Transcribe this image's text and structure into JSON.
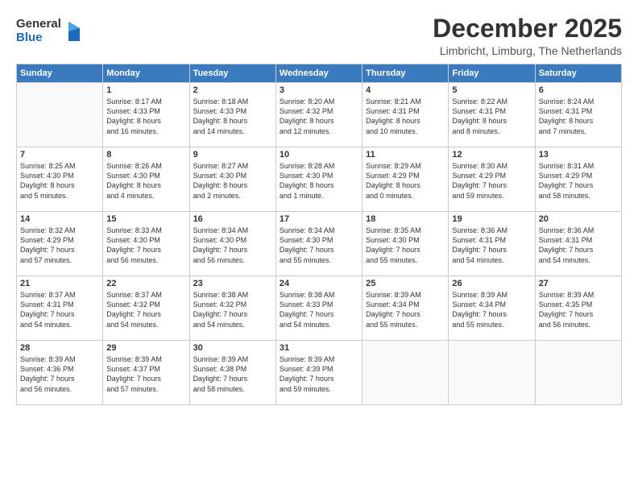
{
  "logo": {
    "general": "General",
    "blue": "Blue"
  },
  "header": {
    "month": "December 2025",
    "location": "Limbricht, Limburg, The Netherlands"
  },
  "weekdays": [
    "Sunday",
    "Monday",
    "Tuesday",
    "Wednesday",
    "Thursday",
    "Friday",
    "Saturday"
  ],
  "weeks": [
    [
      {
        "day": "",
        "info": ""
      },
      {
        "day": "1",
        "info": "Sunrise: 8:17 AM\nSunset: 4:33 PM\nDaylight: 8 hours\nand 16 minutes."
      },
      {
        "day": "2",
        "info": "Sunrise: 8:18 AM\nSunset: 4:33 PM\nDaylight: 8 hours\nand 14 minutes."
      },
      {
        "day": "3",
        "info": "Sunrise: 8:20 AM\nSunset: 4:32 PM\nDaylight: 8 hours\nand 12 minutes."
      },
      {
        "day": "4",
        "info": "Sunrise: 8:21 AM\nSunset: 4:31 PM\nDaylight: 8 hours\nand 10 minutes."
      },
      {
        "day": "5",
        "info": "Sunrise: 8:22 AM\nSunset: 4:31 PM\nDaylight: 8 hours\nand 8 minutes."
      },
      {
        "day": "6",
        "info": "Sunrise: 8:24 AM\nSunset: 4:31 PM\nDaylight: 8 hours\nand 7 minutes."
      }
    ],
    [
      {
        "day": "7",
        "info": "Sunrise: 8:25 AM\nSunset: 4:30 PM\nDaylight: 8 hours\nand 5 minutes."
      },
      {
        "day": "8",
        "info": "Sunrise: 8:26 AM\nSunset: 4:30 PM\nDaylight: 8 hours\nand 4 minutes."
      },
      {
        "day": "9",
        "info": "Sunrise: 8:27 AM\nSunset: 4:30 PM\nDaylight: 8 hours\nand 2 minutes."
      },
      {
        "day": "10",
        "info": "Sunrise: 8:28 AM\nSunset: 4:30 PM\nDaylight: 8 hours\nand 1 minute."
      },
      {
        "day": "11",
        "info": "Sunrise: 8:29 AM\nSunset: 4:29 PM\nDaylight: 8 hours\nand 0 minutes."
      },
      {
        "day": "12",
        "info": "Sunrise: 8:30 AM\nSunset: 4:29 PM\nDaylight: 7 hours\nand 59 minutes."
      },
      {
        "day": "13",
        "info": "Sunrise: 8:31 AM\nSunset: 4:29 PM\nDaylight: 7 hours\nand 58 minutes."
      }
    ],
    [
      {
        "day": "14",
        "info": "Sunrise: 8:32 AM\nSunset: 4:29 PM\nDaylight: 7 hours\nand 57 minutes."
      },
      {
        "day": "15",
        "info": "Sunrise: 8:33 AM\nSunset: 4:30 PM\nDaylight: 7 hours\nand 56 minutes."
      },
      {
        "day": "16",
        "info": "Sunrise: 8:34 AM\nSunset: 4:30 PM\nDaylight: 7 hours\nand 56 minutes."
      },
      {
        "day": "17",
        "info": "Sunrise: 8:34 AM\nSunset: 4:30 PM\nDaylight: 7 hours\nand 55 minutes."
      },
      {
        "day": "18",
        "info": "Sunrise: 8:35 AM\nSunset: 4:30 PM\nDaylight: 7 hours\nand 55 minutes."
      },
      {
        "day": "19",
        "info": "Sunrise: 8:36 AM\nSunset: 4:31 PM\nDaylight: 7 hours\nand 54 minutes."
      },
      {
        "day": "20",
        "info": "Sunrise: 8:36 AM\nSunset: 4:31 PM\nDaylight: 7 hours\nand 54 minutes."
      }
    ],
    [
      {
        "day": "21",
        "info": "Sunrise: 8:37 AM\nSunset: 4:31 PM\nDaylight: 7 hours\nand 54 minutes."
      },
      {
        "day": "22",
        "info": "Sunrise: 8:37 AM\nSunset: 4:32 PM\nDaylight: 7 hours\nand 54 minutes."
      },
      {
        "day": "23",
        "info": "Sunrise: 8:38 AM\nSunset: 4:32 PM\nDaylight: 7 hours\nand 54 minutes."
      },
      {
        "day": "24",
        "info": "Sunrise: 8:38 AM\nSunset: 4:33 PM\nDaylight: 7 hours\nand 54 minutes."
      },
      {
        "day": "25",
        "info": "Sunrise: 8:39 AM\nSunset: 4:34 PM\nDaylight: 7 hours\nand 55 minutes."
      },
      {
        "day": "26",
        "info": "Sunrise: 8:39 AM\nSunset: 4:34 PM\nDaylight: 7 hours\nand 55 minutes."
      },
      {
        "day": "27",
        "info": "Sunrise: 8:39 AM\nSunset: 4:35 PM\nDaylight: 7 hours\nand 56 minutes."
      }
    ],
    [
      {
        "day": "28",
        "info": "Sunrise: 8:39 AM\nSunset: 4:36 PM\nDaylight: 7 hours\nand 56 minutes."
      },
      {
        "day": "29",
        "info": "Sunrise: 8:39 AM\nSunset: 4:37 PM\nDaylight: 7 hours\nand 57 minutes."
      },
      {
        "day": "30",
        "info": "Sunrise: 8:39 AM\nSunset: 4:38 PM\nDaylight: 7 hours\nand 58 minutes."
      },
      {
        "day": "31",
        "info": "Sunrise: 8:39 AM\nSunset: 4:39 PM\nDaylight: 7 hours\nand 59 minutes."
      },
      {
        "day": "",
        "info": ""
      },
      {
        "day": "",
        "info": ""
      },
      {
        "day": "",
        "info": ""
      }
    ]
  ]
}
